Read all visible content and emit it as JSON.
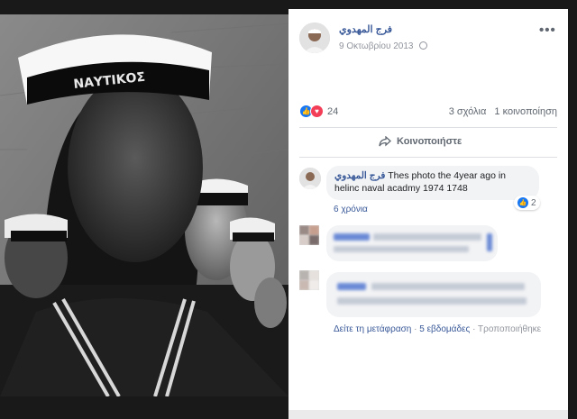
{
  "post": {
    "author": "فرج المهدوي",
    "date": "9 Οκτωβρίου 2013",
    "privacy_icon": "globe-icon",
    "more_icon": "more-icon",
    "more_label": "•••",
    "photo_cap_text": "ΝΑΥΤΙΚΟΣ"
  },
  "stats": {
    "reaction_count": "24",
    "comments": "3 σχόλια",
    "shares": "1 κοινοποίηση"
  },
  "actions": {
    "share_label": "Κοινοποιήστε"
  },
  "comments": [
    {
      "author": "فرج المهدوي",
      "text": "Thes photo the 4year ago in helinc naval acadmy 1974 1748",
      "time": "6 χρόνια",
      "likes": "2"
    },
    {
      "author": "",
      "text": "",
      "blurred": true
    },
    {
      "author": "",
      "text": "",
      "blurred": true,
      "see_translation": "Δείτε τη μετάφραση",
      "time": "5 εβδομάδες",
      "edited": "Τροποποιήθηκε"
    }
  ],
  "colors": {
    "link": "#385898",
    "like": "#1877f2",
    "love": "#f33e58",
    "muted": "#90949c"
  }
}
